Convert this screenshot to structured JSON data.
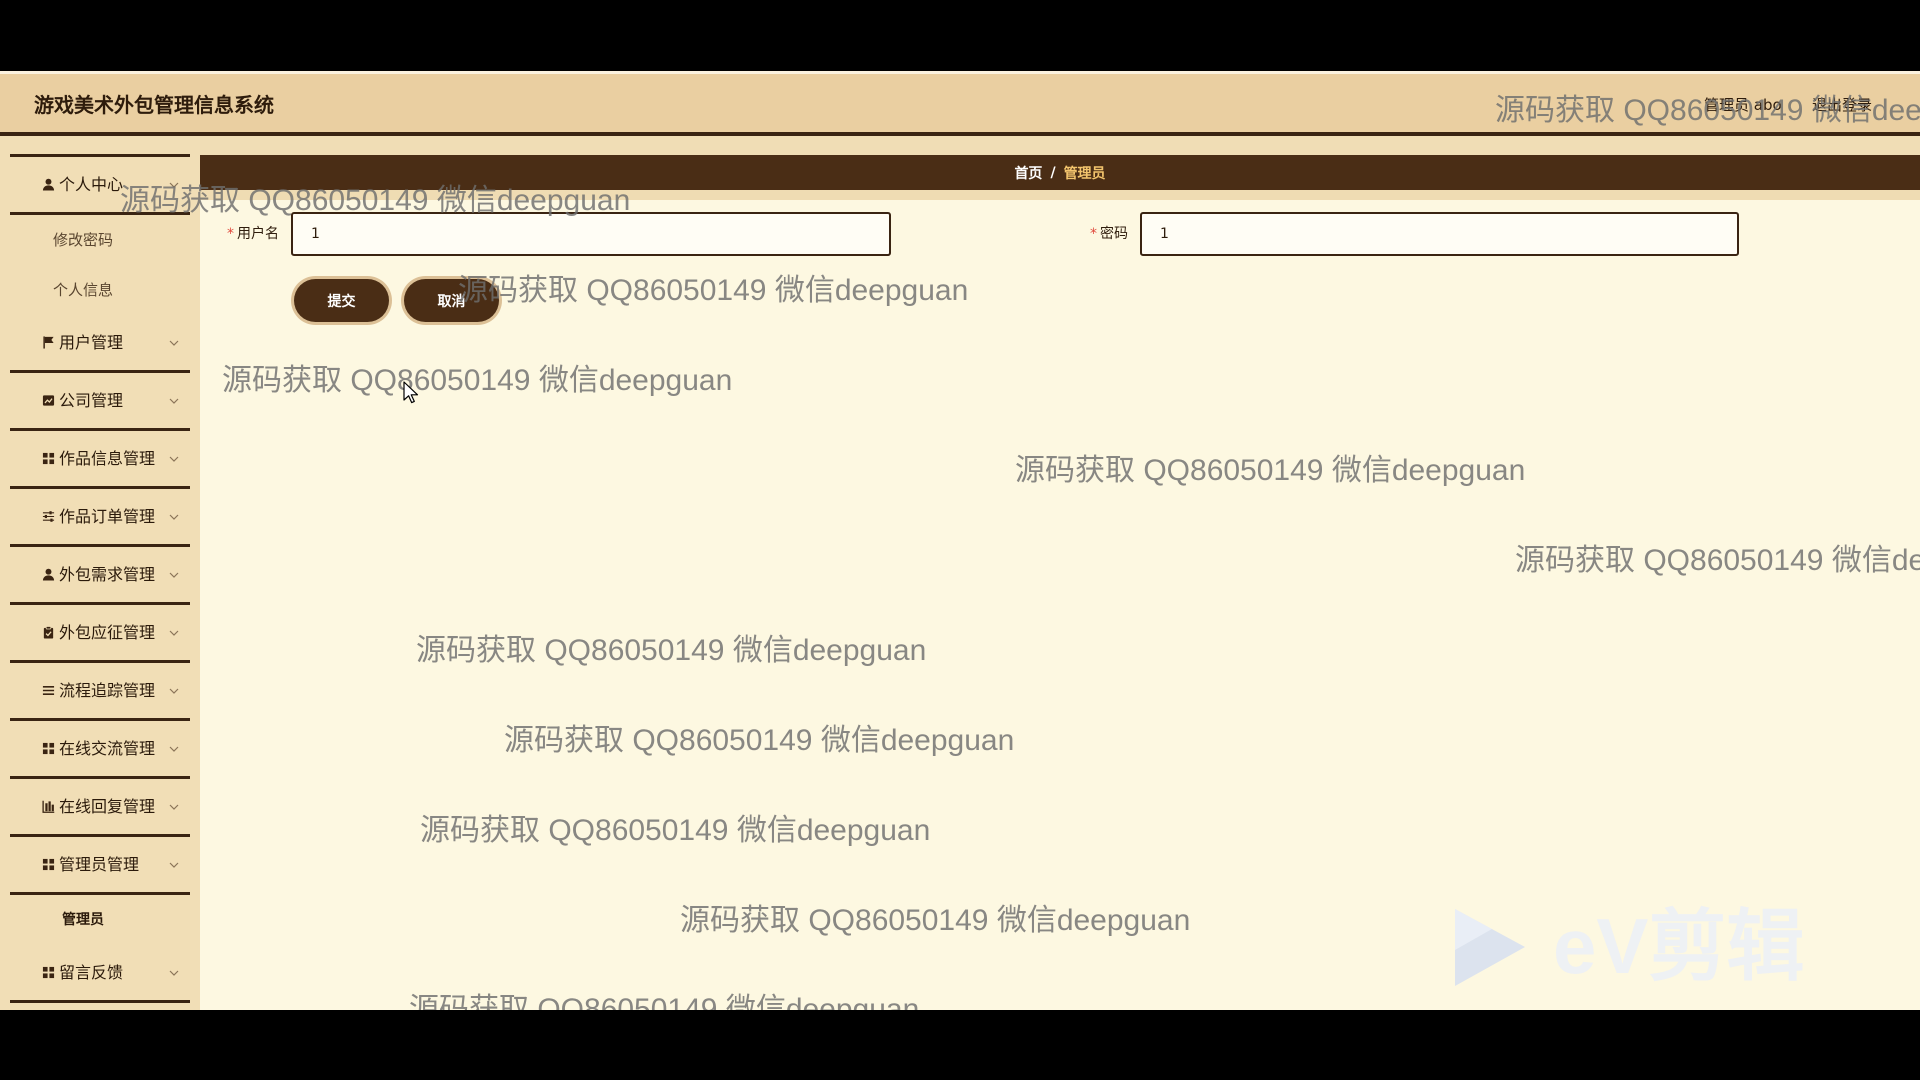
{
  "app": {
    "title": "游戏美术外包管理信息系统"
  },
  "header": {
    "user_label": "管理员 abo",
    "logout_label": "退出登录"
  },
  "sidebar": {
    "groups": [
      {
        "label": "个人中心",
        "icon": "user-icon",
        "expanded": true,
        "children": [
          {
            "label": "修改密码"
          },
          {
            "label": "个人信息"
          }
        ]
      },
      {
        "label": "用户管理",
        "icon": "flag-icon"
      },
      {
        "label": "公司管理",
        "icon": "chart-icon"
      },
      {
        "label": "作品信息管理",
        "icon": "grid-icon"
      },
      {
        "label": "作品订单管理",
        "icon": "sliders-icon"
      },
      {
        "label": "外包需求管理",
        "icon": "user-icon"
      },
      {
        "label": "外包应征管理",
        "icon": "clipboard-check-icon"
      },
      {
        "label": "流程追踪管理",
        "icon": "list-icon"
      },
      {
        "label": "在线交流管理",
        "icon": "grid-icon"
      },
      {
        "label": "在线回复管理",
        "icon": "bar-chart-icon"
      },
      {
        "label": "管理员管理",
        "icon": "grid-icon",
        "expanded": true,
        "children": [
          {
            "label": "管理员",
            "active": true
          }
        ]
      },
      {
        "label": "留言反馈",
        "icon": "grid-icon"
      }
    ]
  },
  "breadcrumb": {
    "home": "首页",
    "separator": "/",
    "current": "管理员"
  },
  "form": {
    "username": {
      "required_mark": "*",
      "label": "用户名",
      "value": "1"
    },
    "password": {
      "required_mark": "*",
      "label": "密码",
      "value": "1"
    },
    "submit_label": "提交",
    "cancel_label": "取消"
  },
  "watermark": {
    "text": "源码获取 QQ86050149 微信deepguan"
  },
  "video_logo": {
    "text": "eV剪辑",
    "icon": "play-logo-icon"
  },
  "colors": {
    "header_bg": "#eacfa1",
    "sidebar_bg": "#f1deb6",
    "main_bg": "#fdf8e1",
    "accent_dark": "#4a2d15",
    "divider": "#3a2412",
    "breadcrumb_current": "#f2c46d",
    "required_mark": "#e0483c"
  }
}
